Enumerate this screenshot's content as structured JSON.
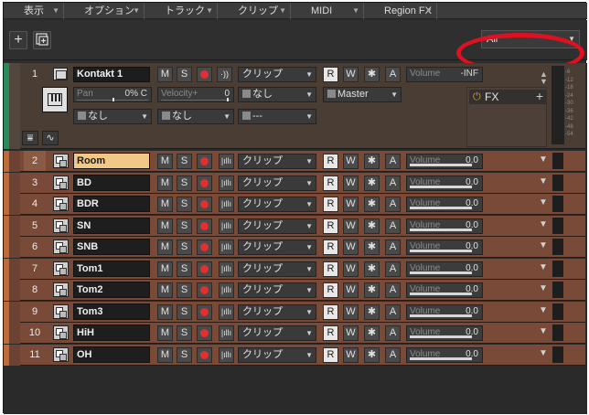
{
  "menubar": {
    "items": [
      {
        "label": "表示"
      },
      {
        "label": "オプション"
      },
      {
        "label": "トラック"
      },
      {
        "label": "クリップ"
      },
      {
        "label": "MIDI"
      },
      {
        "label": "Region FX"
      }
    ]
  },
  "toolbar": {
    "add_track_label": "+",
    "filter": {
      "value": "All"
    }
  },
  "instrument_track": {
    "number": "1",
    "name": "Kontakt 1",
    "mute": "M",
    "solo": "S",
    "input_echo": "·))",
    "clip_mode": "クリップ",
    "read": "R",
    "write": "W",
    "aux": "✱",
    "auto": "A",
    "volume_label": "Volume",
    "volume_value": "-INF",
    "pan_label": "Pan",
    "pan_value": "0% C",
    "velocity_label": "Velocity+",
    "velocity_value": "0",
    "input": "なし",
    "output": "Master",
    "channel_a": "なし",
    "channel_b": "なし",
    "patch": "---",
    "fx_label": "FX",
    "meter_scale": [
      "-6",
      "-12",
      "-18",
      "-24",
      "-30",
      "-36",
      "-42",
      "-48",
      "-54"
    ],
    "pan_position": 0.5,
    "velocity_position": 0.95
  },
  "audio_tracks": [
    {
      "number": "2",
      "name": "Room",
      "clip_mode": "クリップ",
      "volume_label": "Volume",
      "volume_value": "0.0",
      "selected": true
    },
    {
      "number": "3",
      "name": "BD",
      "clip_mode": "クリップ",
      "volume_label": "Volume",
      "volume_value": "0.0"
    },
    {
      "number": "4",
      "name": "BDR",
      "clip_mode": "クリップ",
      "volume_label": "Volume",
      "volume_value": "0.0"
    },
    {
      "number": "5",
      "name": "SN",
      "clip_mode": "クリップ",
      "volume_label": "Volume",
      "volume_value": "0.0"
    },
    {
      "number": "6",
      "name": "SNB",
      "clip_mode": "クリップ",
      "volume_label": "Volume",
      "volume_value": "0.0"
    },
    {
      "number": "7",
      "name": "Tom1",
      "clip_mode": "クリップ",
      "volume_label": "Volume",
      "volume_value": "0.0"
    },
    {
      "number": "8",
      "name": "Tom2",
      "clip_mode": "クリップ",
      "volume_label": "Volume",
      "volume_value": "0.0"
    },
    {
      "number": "9",
      "name": "Tom3",
      "clip_mode": "クリップ",
      "volume_label": "Volume",
      "volume_value": "0.0"
    },
    {
      "number": "10",
      "name": "HiH",
      "clip_mode": "クリップ",
      "volume_label": "Volume",
      "volume_value": "0.0"
    },
    {
      "number": "11",
      "name": "OH",
      "clip_mode": "クリップ",
      "volume_label": "Volume",
      "volume_value": "0.0"
    }
  ],
  "track_buttons": {
    "mute": "M",
    "solo": "S",
    "read": "R",
    "write": "W",
    "aux": "✱",
    "auto": "A"
  },
  "volume_fill": 0.9,
  "colors": {
    "highlight": "#e01020",
    "track_audio": "#7a4a38",
    "track_instrument": "#4a3d34",
    "selected_name": "#f2c888",
    "record": "#e23030",
    "stripe_instrument": "#2a8a5a",
    "stripe_audio": "#c06a3a"
  },
  "icons": [
    "add-icon",
    "duplicate-track-icon",
    "instrument-icon",
    "piano-keyboard-icon",
    "audio-track-icon",
    "record-icon",
    "input-echo-icon",
    "waveform-icon",
    "power-icon",
    "chevron-down-icon"
  ]
}
